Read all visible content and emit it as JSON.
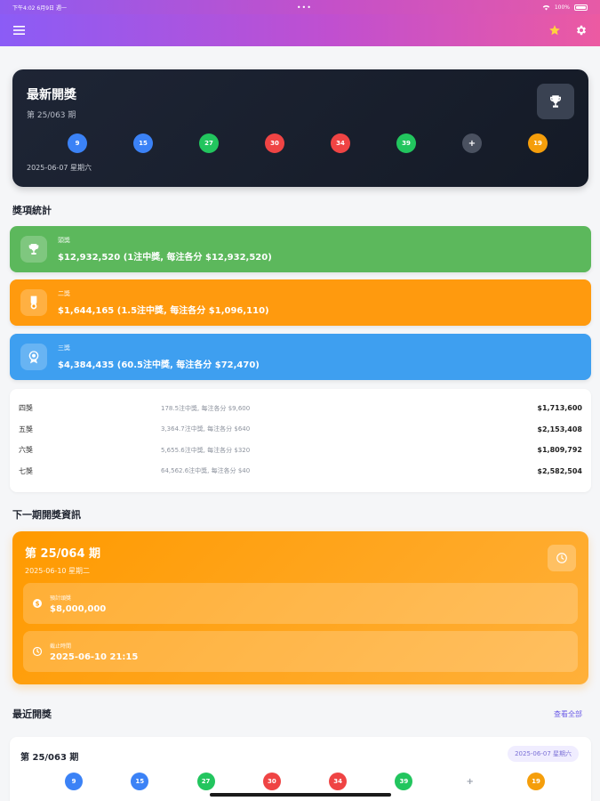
{
  "status_bar": {
    "time": "下午4:02",
    "date": "6月9日 週一",
    "dots": "•••",
    "battery": "100%"
  },
  "app_bar": {
    "menu_icon": "hamburger-icon",
    "star_icon": "star-icon",
    "settings_icon": "gear-icon",
    "star_color": "#ffd23f"
  },
  "latest": {
    "title": "最新開獎",
    "period": "第 25/063 期",
    "date": "2025-06-07 星期六",
    "balls": [
      {
        "num": "9",
        "color": "#3b82f6"
      },
      {
        "num": "15",
        "color": "#3b82f6"
      },
      {
        "num": "27",
        "color": "#22c55e"
      },
      {
        "num": "30",
        "color": "#ef4444"
      },
      {
        "num": "34",
        "color": "#ef4444"
      },
      {
        "num": "39",
        "color": "#22c55e"
      }
    ],
    "plus": "+",
    "special": {
      "num": "19",
      "color": "#f59e0b"
    }
  },
  "prize_section": {
    "title": "獎項統計",
    "top": [
      {
        "name": "頭獎",
        "detail": "$12,932,520 (1注中獎, 每注各分 $12,932,520)",
        "color": "#5cb85c",
        "icon": "trophy-icon"
      },
      {
        "name": "二獎",
        "detail": "$1,644,165 (1.5注中獎, 每注各分 $1,096,110)",
        "color": "#ff9a0e",
        "icon": "medal-icon"
      },
      {
        "name": "三獎",
        "detail": "$4,384,435 (60.5注中獎, 每注各分 $72,470)",
        "color": "#3e9ff0",
        "icon": "badge-icon"
      }
    ],
    "rows": [
      {
        "name": "四獎",
        "winners": "178.5注中獎, 每注各分 $9,600",
        "amount": "$1,713,600"
      },
      {
        "name": "五獎",
        "winners": "3,364.7注中獎, 每注各分 $640",
        "amount": "$2,153,408"
      },
      {
        "name": "六獎",
        "winners": "5,655.6注中獎, 每注各分 $320",
        "amount": "$1,809,792"
      },
      {
        "name": "七獎",
        "winners": "64,562.6注中獎, 每注各分 $40",
        "amount": "$2,582,504"
      }
    ]
  },
  "next_section": {
    "title": "下一期開獎資訊",
    "period": "第 25/064 期",
    "date": "2025-06-10 星期二",
    "jackpot_label": "預計頭獎",
    "jackpot_value": "$8,000,000",
    "deadline_label": "截止時間",
    "deadline_value": "2025-06-10 21:15"
  },
  "recent_section": {
    "title": "最近開獎",
    "view_all": "查看全部",
    "period": "第 25/063 期",
    "date": "2025-06-07 星期六",
    "balls": [
      {
        "num": "9",
        "color": "#3b82f6"
      },
      {
        "num": "15",
        "color": "#3b82f6"
      },
      {
        "num": "27",
        "color": "#22c55e"
      },
      {
        "num": "30",
        "color": "#ef4444"
      },
      {
        "num": "34",
        "color": "#ef4444"
      },
      {
        "num": "39",
        "color": "#22c55e"
      }
    ],
    "plus": "+",
    "special": {
      "num": "19",
      "color": "#f59e0b"
    }
  }
}
